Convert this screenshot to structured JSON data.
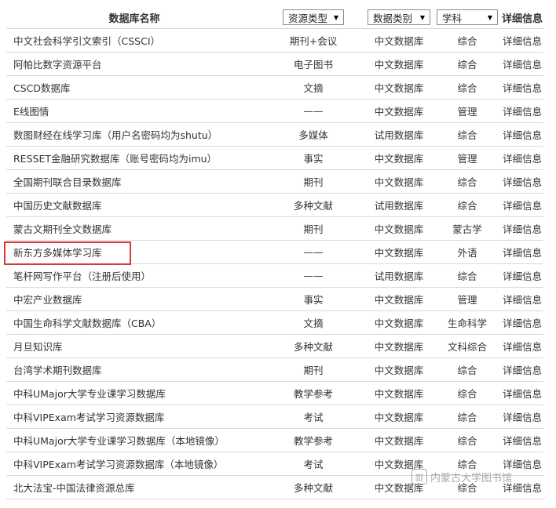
{
  "header": {
    "name_label": "数据库名称",
    "type_filter": "资源类型",
    "category_filter": "数据类别",
    "subject_filter": "学科",
    "detail_label": "详细信息"
  },
  "rows": [
    {
      "name": "中文社会科学引文索引（CSSCI）",
      "type": "期刊+会议",
      "category": "中文数据库",
      "subject": "综合",
      "detail": "详细信息"
    },
    {
      "name": "阿帕比数字资源平台",
      "type": "电子图书",
      "category": "中文数据库",
      "subject": "综合",
      "detail": "详细信息"
    },
    {
      "name": "CSCD数据库",
      "type": "文摘",
      "category": "中文数据库",
      "subject": "综合",
      "detail": "详细信息"
    },
    {
      "name": "E线图情",
      "type": "——",
      "category": "中文数据库",
      "subject": "管理",
      "detail": "详细信息"
    },
    {
      "name": "数图财经在线学习库（用户名密码均为shutu）",
      "type": "多媒体",
      "category": "试用数据库",
      "subject": "综合",
      "detail": "详细信息"
    },
    {
      "name": "RESSET金融研究数据库（账号密码均为imu）",
      "type": "事实",
      "category": "中文数据库",
      "subject": "管理",
      "detail": "详细信息"
    },
    {
      "name": "全国期刊联合目录数据库",
      "type": "期刊",
      "category": "中文数据库",
      "subject": "综合",
      "detail": "详细信息"
    },
    {
      "name": "中国历史文献数据库",
      "type": "多种文献",
      "category": "试用数据库",
      "subject": "综合",
      "detail": "详细信息"
    },
    {
      "name": "蒙古文期刊全文数据库",
      "type": "期刊",
      "category": "中文数据库",
      "subject": "蒙古学",
      "detail": "详细信息"
    },
    {
      "name": "新东方多媒体学习库",
      "type": "——",
      "category": "中文数据库",
      "subject": "外语",
      "detail": "详细信息"
    },
    {
      "name": "笔杆网写作平台（注册后使用）",
      "type": "——",
      "category": "试用数据库",
      "subject": "综合",
      "detail": "详细信息"
    },
    {
      "name": "中宏产业数据库",
      "type": "事实",
      "category": "中文数据库",
      "subject": "管理",
      "detail": "详细信息"
    },
    {
      "name": "中国生命科学文献数据库（CBA）",
      "type": "文摘",
      "category": "中文数据库",
      "subject": "生命科学",
      "detail": "详细信息"
    },
    {
      "name": "月旦知识库",
      "type": "多种文献",
      "category": "中文数据库",
      "subject": "文科综合",
      "detail": "详细信息"
    },
    {
      "name": "台湾学术期刊数据库",
      "type": "期刊",
      "category": "中文数据库",
      "subject": "综合",
      "detail": "详细信息"
    },
    {
      "name": "中科UMajor大学专业课学习数据库",
      "type": "教学参考",
      "category": "中文数据库",
      "subject": "综合",
      "detail": "详细信息"
    },
    {
      "name": "中科VIPExam考试学习资源数据库",
      "type": "考试",
      "category": "中文数据库",
      "subject": "综合",
      "detail": "详细信息"
    },
    {
      "name": "中科UMajor大学专业课学习数据库（本地镜像）",
      "type": "教学参考",
      "category": "中文数据库",
      "subject": "综合",
      "detail": "详细信息"
    },
    {
      "name": "中科VIPExam考试学习资源数据库（本地镜像）",
      "type": "考试",
      "category": "中文数据库",
      "subject": "综合",
      "detail": "详细信息"
    },
    {
      "name": "北大法宝-中国法律资源总库",
      "type": "多种文献",
      "category": "中文数据库",
      "subject": "综合",
      "detail": "详细信息"
    }
  ],
  "highlight": {
    "row_name": "新东方多媒体学习库",
    "color": "#d93a3a"
  },
  "watermark": {
    "text": "内蒙古大学图书馆",
    "icon": "library-logo-icon"
  }
}
